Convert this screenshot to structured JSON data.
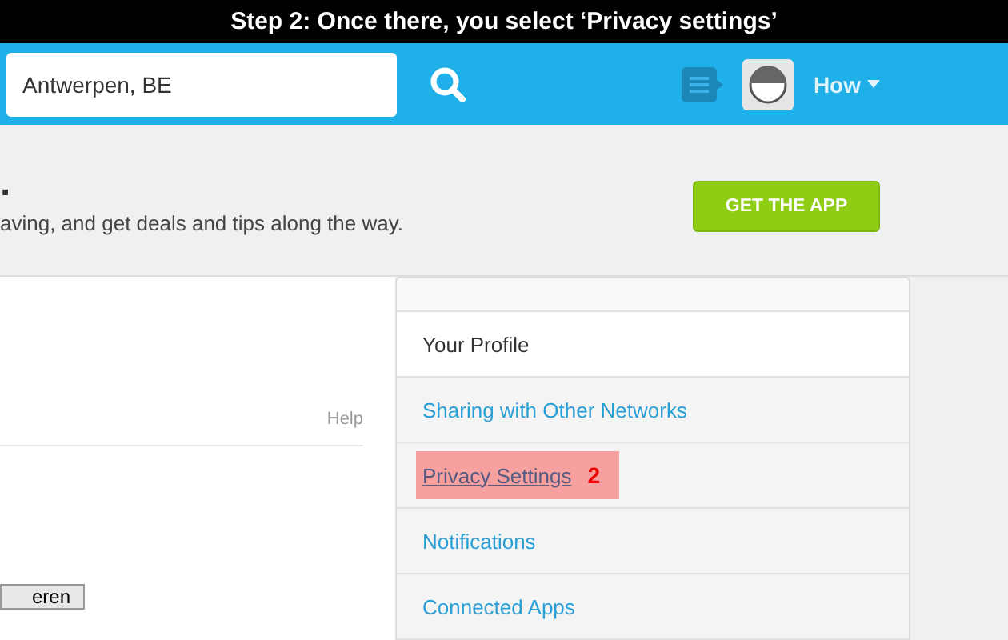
{
  "caption": "Step 2: Once there, you select ‘Privacy settings’",
  "header": {
    "search_value": "Antwerpen, BE",
    "user_name": "How"
  },
  "intro": {
    "heading": ".",
    "subtitle": "aving, and get deals and tips along the way.",
    "app_button": "GET THE APP"
  },
  "panel": {
    "help_link": "Help",
    "button": "eren"
  },
  "sidebar": {
    "items": [
      {
        "label": "Your Profile",
        "selected": true,
        "highlighted": false
      },
      {
        "label": "Sharing with Other Networks",
        "selected": false,
        "highlighted": false
      },
      {
        "label": "Privacy Settings",
        "selected": false,
        "highlighted": true,
        "step": "2"
      },
      {
        "label": "Notifications",
        "selected": false,
        "highlighted": false
      },
      {
        "label": "Connected Apps",
        "selected": false,
        "highlighted": false
      }
    ]
  }
}
